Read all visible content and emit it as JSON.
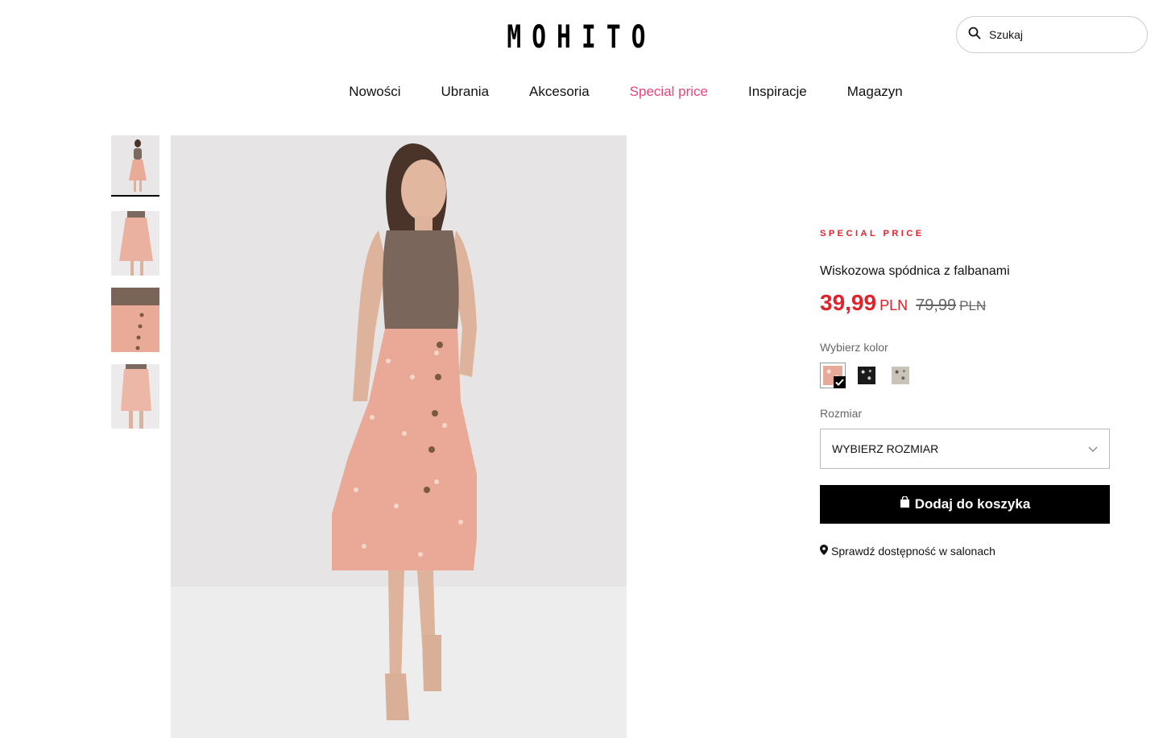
{
  "header": {
    "logo": "MOHITO",
    "search_placeholder": "Szukaj"
  },
  "nav": {
    "items": [
      "Nowości",
      "Ubrania",
      "Akcesoria",
      "Special price",
      "Inspiracje",
      "Magazyn"
    ],
    "highlight_color": "#e8447a"
  },
  "gallery": {
    "thumbnail_count": 4,
    "active_thumbnail": 1,
    "icons": [
      "product-photo",
      "skirt-detail-photo"
    ]
  },
  "product": {
    "badge": "SPECIAL PRICE",
    "title": "Wiskozowa spódnica z falbanami",
    "price_now": "39,99",
    "currency": "PLN",
    "price_old": "79,99",
    "price_color": "#e0222b",
    "color_label": "Wybierz kolor",
    "colors": [
      "peach-floral",
      "black-floral",
      "beige-floral"
    ],
    "selected_color": 0,
    "size_label": "Rozmiar",
    "size_placeholder": "WYBIERZ ROZMIAR",
    "cart_button": "Dodaj do koszyka",
    "availability": "Sprawdź dostępność w salonach"
  }
}
